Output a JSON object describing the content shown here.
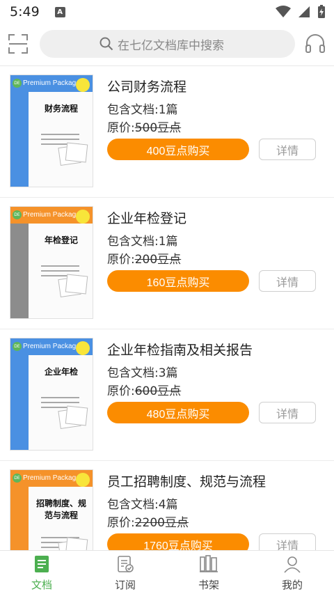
{
  "status": {
    "time": "5:49",
    "notif": "A"
  },
  "search": {
    "placeholder": "在七亿文档库中搜索"
  },
  "items": [
    {
      "title": "公司财务流程",
      "docs": "包含文档:1篇",
      "price_prefix": "原价:",
      "price": "500豆点",
      "buy": "400豆点购买",
      "detail": "详情",
      "cover": {
        "title": "财务流程",
        "accent": "#4a90e2",
        "brand": "Premium Package"
      }
    },
    {
      "title": "企业年检登记",
      "docs": "包含文档:1篇",
      "price_prefix": "原价:",
      "price": "200豆点",
      "buy": "160豆点购买",
      "detail": "详情",
      "cover": {
        "title": "年检登记",
        "accent": "#8c8c8c",
        "brand": "Premium Package"
      }
    },
    {
      "title": "企业年检指南及相关报告",
      "docs": "包含文档:3篇",
      "price_prefix": "原价:",
      "price": "600豆点",
      "buy": "480豆点购买",
      "detail": "详情",
      "cover": {
        "title": "企业年检",
        "accent": "#4a90e2",
        "brand": "Premium Package"
      }
    },
    {
      "title": "员工招聘制度、规范与流程",
      "docs": "包含文档:4篇",
      "price_prefix": "原价:",
      "price": "2200豆点",
      "buy": "1760豆点购买",
      "detail": "详情",
      "cover": {
        "title": "招聘制度、规范与流程",
        "accent": "#f5922a",
        "brand": "Premium Package"
      }
    }
  ],
  "tabs": [
    {
      "label": "文档",
      "icon": "document-icon",
      "active": true
    },
    {
      "label": "订阅",
      "icon": "subscribe-icon",
      "active": false
    },
    {
      "label": "书架",
      "icon": "bookshelf-icon",
      "active": false
    },
    {
      "label": "我的",
      "icon": "profile-icon",
      "active": false
    }
  ],
  "colors": {
    "accent": "#fb8c00",
    "tab_active": "#4caf50"
  }
}
